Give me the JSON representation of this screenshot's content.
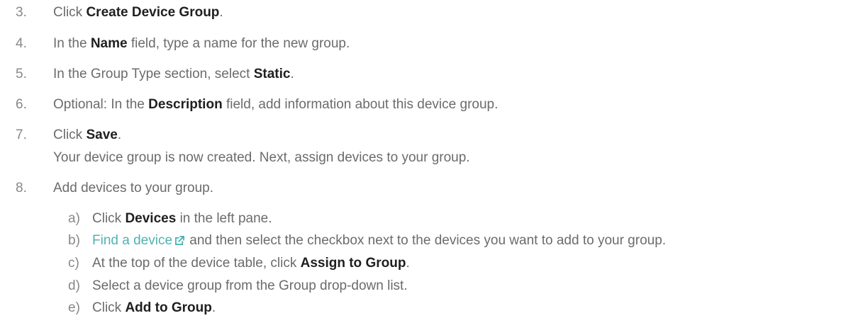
{
  "steps": [
    {
      "num": "3.",
      "pre": "Click ",
      "bold": "Create Device Group",
      "post": "."
    },
    {
      "num": "4.",
      "pre": "In the ",
      "bold": "Name",
      "post": " field, type a name for the new group."
    },
    {
      "num": "5.",
      "pre": "In the Group Type section, select ",
      "bold": "Static",
      "post": "."
    },
    {
      "num": "6.",
      "pre": "Optional: In the ",
      "bold": "Description",
      "post": " field, add information about this device group."
    },
    {
      "num": "7.",
      "pre": "Click ",
      "bold": "Save",
      "post": ".",
      "result": "Your device group is now created. Next, assign devices to your group."
    },
    {
      "num": "8.",
      "text": "Add devices to your group."
    }
  ],
  "substeps": [
    {
      "num": "a)",
      "pre": "Click ",
      "bold": "Devices",
      "post": " in the left pane."
    },
    {
      "num": "b)",
      "link": "Find a device",
      "post": " and then select the checkbox next to the devices you want to add to your group."
    },
    {
      "num": "c)",
      "pre": "At the top of the device table, click ",
      "bold": "Assign to Group",
      "post": "."
    },
    {
      "num": "d)",
      "text": "Select a device group from the Group drop-down list."
    },
    {
      "num": "e)",
      "pre": "Click ",
      "bold": "Add to Group",
      "post": "."
    }
  ],
  "icons": {
    "external_link": "external-link-icon"
  },
  "colors": {
    "text": "#6b6b6b",
    "bold": "#1f1f1f",
    "link": "#4fb3b0"
  }
}
